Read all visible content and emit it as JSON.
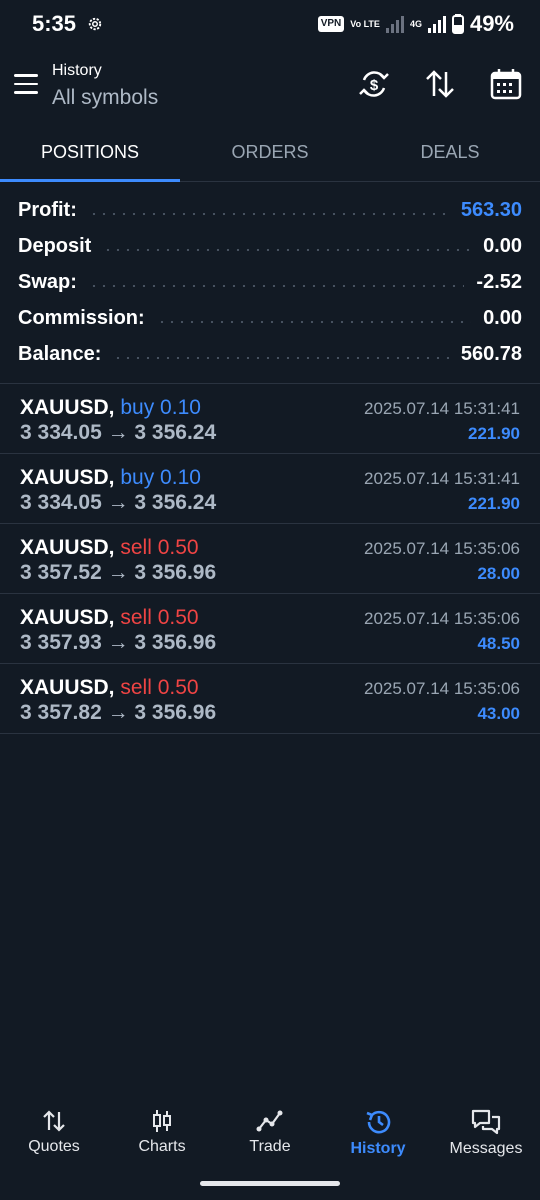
{
  "status_bar": {
    "time": "5:35",
    "vpn": "VPN",
    "volte": "Vo LTE",
    "network": "4G",
    "battery": "49%"
  },
  "header": {
    "title": "History",
    "subtitle": "All symbols"
  },
  "tabs": [
    {
      "label": "POSITIONS",
      "active": true
    },
    {
      "label": "ORDERS",
      "active": false
    },
    {
      "label": "DEALS",
      "active": false
    }
  ],
  "summary": [
    {
      "label": "Profit:",
      "value": "563.30"
    },
    {
      "label": "Deposit",
      "value": "0.00"
    },
    {
      "label": "Swap:",
      "value": "-2.52"
    },
    {
      "label": "Commission:",
      "value": "0.00"
    },
    {
      "label": "Balance:",
      "value": "560.78"
    }
  ],
  "deals": [
    {
      "symbol": "XAUUSD,",
      "side": "buy 0.10",
      "prices": "3 334.05 → 3 356.24",
      "time": "2025.07.14 15:31:41",
      "profit": "221.90"
    },
    {
      "symbol": "XAUUSD,",
      "side": "buy 0.10",
      "prices": "3 334.05 → 3 356.24",
      "time": "2025.07.14 15:31:41",
      "profit": "221.90"
    },
    {
      "symbol": "XAUUSD,",
      "side": "sell 0.50",
      "prices": "3 357.52 → 3 356.96",
      "time": "2025.07.14 15:35:06",
      "profit": "28.00"
    },
    {
      "symbol": "XAUUSD,",
      "side": "sell 0.50",
      "prices": "3 357.93 → 3 356.96",
      "time": "2025.07.14 15:35:06",
      "profit": "48.50"
    },
    {
      "symbol": "XAUUSD,",
      "side": "sell 0.50",
      "prices": "3 357.82 → 3 356.96",
      "time": "2025.07.14 15:35:06",
      "profit": "43.00"
    }
  ],
  "nav": [
    {
      "label": "Quotes",
      "icon": "quotes-icon"
    },
    {
      "label": "Charts",
      "icon": "charts-icon"
    },
    {
      "label": "Trade",
      "icon": "trade-icon"
    },
    {
      "label": "History",
      "icon": "history-icon",
      "active": true
    },
    {
      "label": "Messages",
      "icon": "messages-icon"
    }
  ],
  "colors": {
    "background": "#121a24",
    "accent": "#3d8bfd",
    "sell": "#ef4444",
    "muted": "#9aa6b3"
  }
}
